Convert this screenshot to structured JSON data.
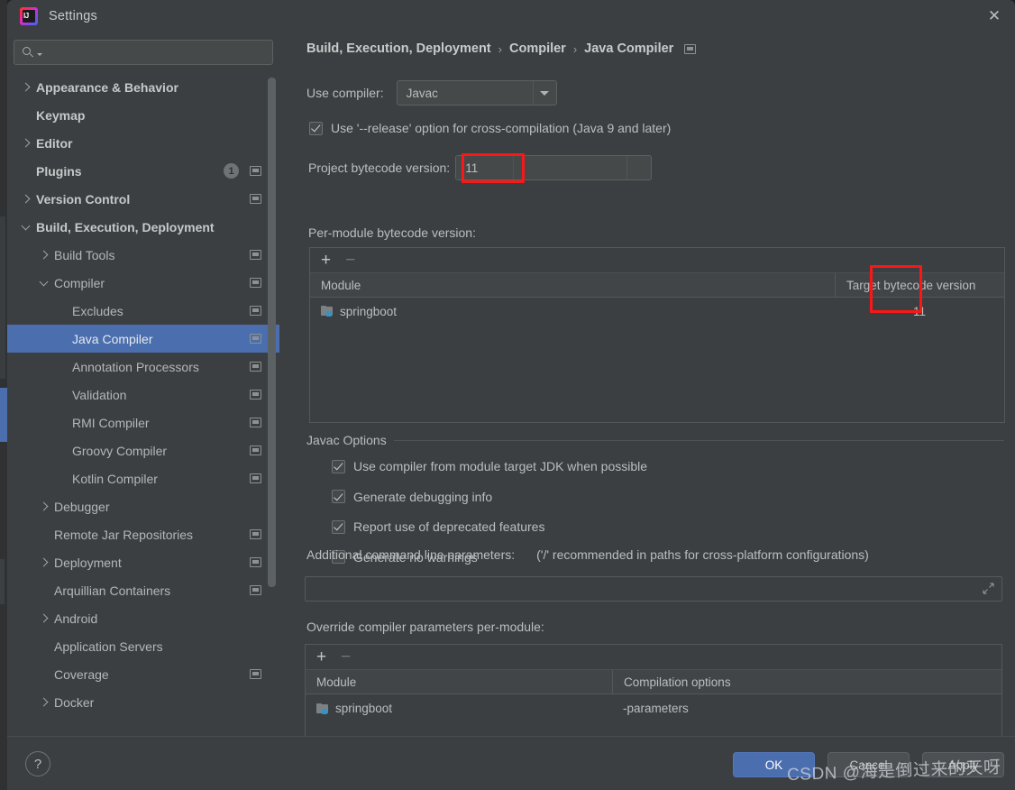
{
  "window": {
    "title": "Settings",
    "app_icon": "intellij-idea-logo",
    "close_label": "✕"
  },
  "search": {
    "value": "",
    "placeholder": ""
  },
  "sidebar": {
    "items": [
      {
        "label": "Appearance & Behavior",
        "indent": 0,
        "twisty": "closed",
        "bold": true,
        "badge": null,
        "cfg": false,
        "selected": false
      },
      {
        "label": "Keymap",
        "indent": 0,
        "twisty": "none",
        "bold": true,
        "badge": null,
        "cfg": false,
        "selected": false
      },
      {
        "label": "Editor",
        "indent": 0,
        "twisty": "closed",
        "bold": true,
        "badge": null,
        "cfg": false,
        "selected": false
      },
      {
        "label": "Plugins",
        "indent": 0,
        "twisty": "none",
        "bold": true,
        "badge": "1",
        "cfg": true,
        "selected": false
      },
      {
        "label": "Version Control",
        "indent": 0,
        "twisty": "closed",
        "bold": true,
        "badge": null,
        "cfg": true,
        "selected": false
      },
      {
        "label": "Build, Execution, Deployment",
        "indent": 0,
        "twisty": "open",
        "bold": true,
        "badge": null,
        "cfg": false,
        "selected": false
      },
      {
        "label": "Build Tools",
        "indent": 1,
        "twisty": "closed",
        "bold": false,
        "badge": null,
        "cfg": true,
        "selected": false
      },
      {
        "label": "Compiler",
        "indent": 1,
        "twisty": "open",
        "bold": false,
        "badge": null,
        "cfg": true,
        "selected": false
      },
      {
        "label": "Excludes",
        "indent": 2,
        "twisty": "none",
        "bold": false,
        "badge": null,
        "cfg": true,
        "selected": false
      },
      {
        "label": "Java Compiler",
        "indent": 2,
        "twisty": "none",
        "bold": false,
        "badge": null,
        "cfg": true,
        "selected": true
      },
      {
        "label": "Annotation Processors",
        "indent": 2,
        "twisty": "none",
        "bold": false,
        "badge": null,
        "cfg": true,
        "selected": false
      },
      {
        "label": "Validation",
        "indent": 2,
        "twisty": "none",
        "bold": false,
        "badge": null,
        "cfg": true,
        "selected": false
      },
      {
        "label": "RMI Compiler",
        "indent": 2,
        "twisty": "none",
        "bold": false,
        "badge": null,
        "cfg": true,
        "selected": false
      },
      {
        "label": "Groovy Compiler",
        "indent": 2,
        "twisty": "none",
        "bold": false,
        "badge": null,
        "cfg": true,
        "selected": false
      },
      {
        "label": "Kotlin Compiler",
        "indent": 2,
        "twisty": "none",
        "bold": false,
        "badge": null,
        "cfg": true,
        "selected": false
      },
      {
        "label": "Debugger",
        "indent": 1,
        "twisty": "closed",
        "bold": false,
        "badge": null,
        "cfg": false,
        "selected": false
      },
      {
        "label": "Remote Jar Repositories",
        "indent": 1,
        "twisty": "none",
        "bold": false,
        "badge": null,
        "cfg": true,
        "selected": false
      },
      {
        "label": "Deployment",
        "indent": 1,
        "twisty": "closed",
        "bold": false,
        "badge": null,
        "cfg": true,
        "selected": false
      },
      {
        "label": "Arquillian Containers",
        "indent": 1,
        "twisty": "none",
        "bold": false,
        "badge": null,
        "cfg": true,
        "selected": false
      },
      {
        "label": "Android",
        "indent": 1,
        "twisty": "closed",
        "bold": false,
        "badge": null,
        "cfg": false,
        "selected": false
      },
      {
        "label": "Application Servers",
        "indent": 1,
        "twisty": "none",
        "bold": false,
        "badge": null,
        "cfg": false,
        "selected": false
      },
      {
        "label": "Coverage",
        "indent": 1,
        "twisty": "none",
        "bold": false,
        "badge": null,
        "cfg": true,
        "selected": false
      },
      {
        "label": "Docker",
        "indent": 1,
        "twisty": "closed",
        "bold": false,
        "badge": null,
        "cfg": false,
        "selected": false
      }
    ]
  },
  "breadcrumb": {
    "crumb1": "Build, Execution, Deployment",
    "crumb2": "Compiler",
    "crumb3": "Java Compiler",
    "sep": "›"
  },
  "main": {
    "use_compiler_label": "Use compiler:",
    "use_compiler_value": "Javac",
    "release_option_label": "Use '--release' option for cross-compilation (Java 9 and later)",
    "release_option_checked": "true",
    "project_bytecode_label": "Project bytecode version:",
    "project_bytecode_value": "11",
    "per_module_label": "Per-module bytecode version:",
    "toolbar_add": "+",
    "toolbar_remove": "−",
    "bytecode_table": {
      "columns": [
        "Module",
        "Target bytecode version"
      ],
      "rows": [
        {
          "module": "springboot",
          "target": "11"
        }
      ]
    },
    "javac_group_title": "Javac Options",
    "javac_options": [
      {
        "label": "Use compiler from module target JDK when possible",
        "checked": "true"
      },
      {
        "label": "Generate debugging info",
        "checked": "true"
      },
      {
        "label": "Report use of deprecated features",
        "checked": "true"
      },
      {
        "label": "Generate no warnings",
        "checked": "false"
      }
    ],
    "additional_params_label": "Additional command line parameters:",
    "additional_params_hint": "('/' recommended in paths for cross-platform configurations)",
    "additional_params_value": "",
    "override_label": "Override compiler parameters per-module:",
    "override_table": {
      "columns": [
        "Module",
        "Compilation options"
      ],
      "rows": [
        {
          "module": "springboot",
          "options": "-parameters"
        }
      ]
    }
  },
  "footer": {
    "help": "?",
    "ok": "OK",
    "cancel": "Cancel",
    "apply": "Apply"
  },
  "watermark": "CSDN @海是倒过来的天呀",
  "colors": {
    "accent": "#4b6eaf",
    "panel": "#3c3f41",
    "highlight": "#fb1717",
    "module_chip": "#3592c4"
  }
}
